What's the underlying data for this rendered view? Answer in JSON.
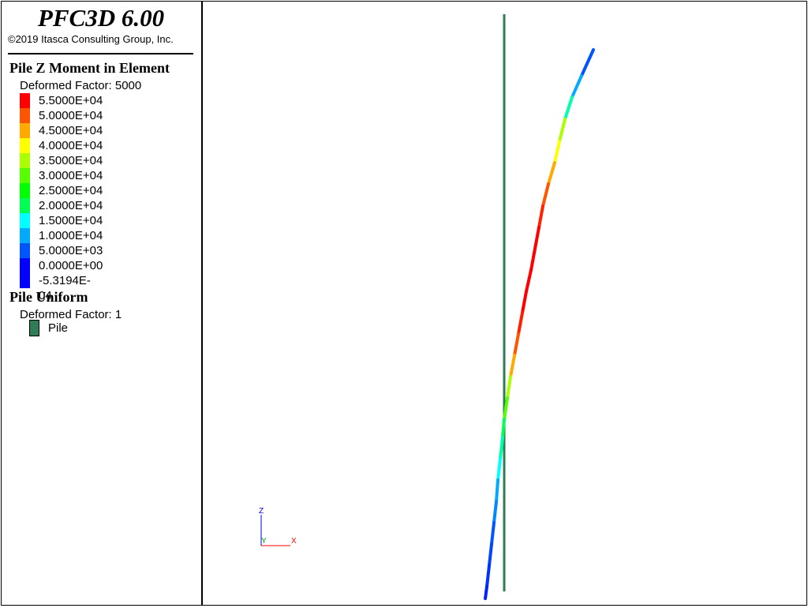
{
  "app": {
    "title": "PFC3D 6.00",
    "copyright": "©2019 Itasca Consulting Group, Inc."
  },
  "legend": {
    "moment": {
      "title": "Pile Z Moment in Element",
      "factor": "Deformed Factor: 5000",
      "entries": [
        {
          "label": "5.5000E+04",
          "color": "#ff0000"
        },
        {
          "label": "5.0000E+04",
          "color": "#ff5500"
        },
        {
          "label": "4.5000E+04",
          "color": "#ffaa00"
        },
        {
          "label": "4.0000E+04",
          "color": "#ffff00"
        },
        {
          "label": "3.5000E+04",
          "color": "#aaff00"
        },
        {
          "label": "3.0000E+04",
          "color": "#55ff00"
        },
        {
          "label": "2.5000E+04",
          "color": "#00ff00"
        },
        {
          "label": "2.0000E+04",
          "color": "#00ff55"
        },
        {
          "label": "1.5000E+04",
          "color": "#00ffff"
        },
        {
          "label": "1.0000E+04",
          "color": "#00aaff"
        },
        {
          "label": "5.0000E+03",
          "color": "#0055ff"
        },
        {
          "label": "0.0000E+00",
          "color": "#0000ff"
        },
        {
          "label": "-5.3194E-04",
          "color": "#0000ff"
        }
      ]
    },
    "uniform": {
      "title": "Pile Uniform",
      "factor": "Deformed Factor: 1",
      "item_label": "Pile",
      "item_color": "#2e7d55"
    }
  },
  "axes": {
    "z_label": "Z",
    "y_label": "Y",
    "x_label": "X"
  }
}
